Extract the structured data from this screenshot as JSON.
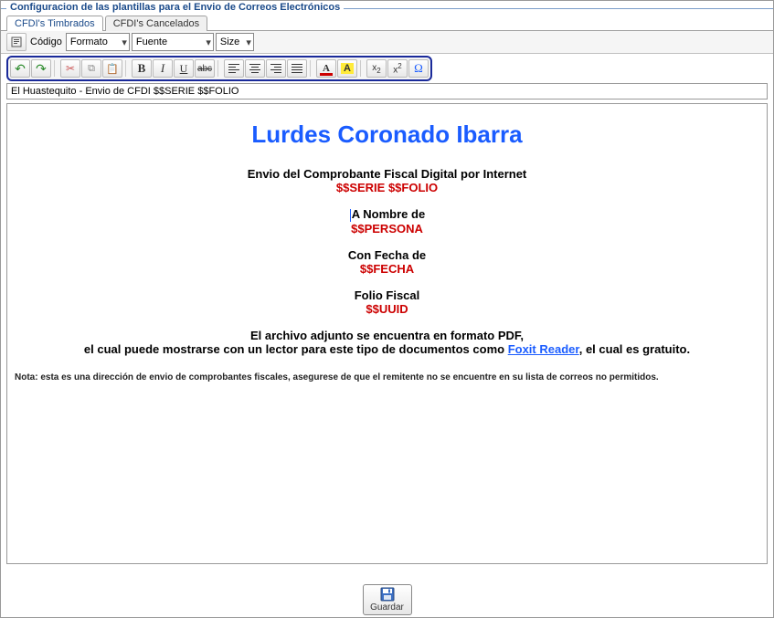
{
  "panel": {
    "title": "Configuracion de las plantillas para el Envio de Correos Electrónicos"
  },
  "tabs": {
    "timbrados": "CFDI's Timbrados",
    "cancelados": "CFDI's Cancelados"
  },
  "toolbar": {
    "codigo": "Código",
    "formato_label": "Formato",
    "fuente_label": "Fuente",
    "size_label": "Size"
  },
  "subject": "El Huastequito - Envio de CFDI $$SERIE $$FOLIO",
  "content": {
    "company": "Lurdes Coronado Ibarra",
    "line1_label": "Envio del Comprobante Fiscal Digital por Internet",
    "line1_value": "$$SERIE $$FOLIO",
    "line2_label": "A Nombre de",
    "line2_value": "$$PERSONA",
    "line3_label": "Con Fecha de",
    "line3_value": "$$FECHA",
    "line4_label": "Folio Fiscal",
    "line4_value": "$$UUID",
    "pdf_line1": "El archivo adjunto se encuentra en formato PDF,",
    "pdf_line2_a": "el cual puede mostrarse con un lector para este tipo de documentos como ",
    "pdf_link": "Foxit Reader",
    "pdf_line2_b": ", el cual es gratuito.",
    "note": "Nota: esta es una dirección de envio de comprobantes fiscales, asegurese de que el remitente no se encuentre en su lista de correos no permitidos."
  },
  "actions": {
    "save": "Guardar"
  }
}
